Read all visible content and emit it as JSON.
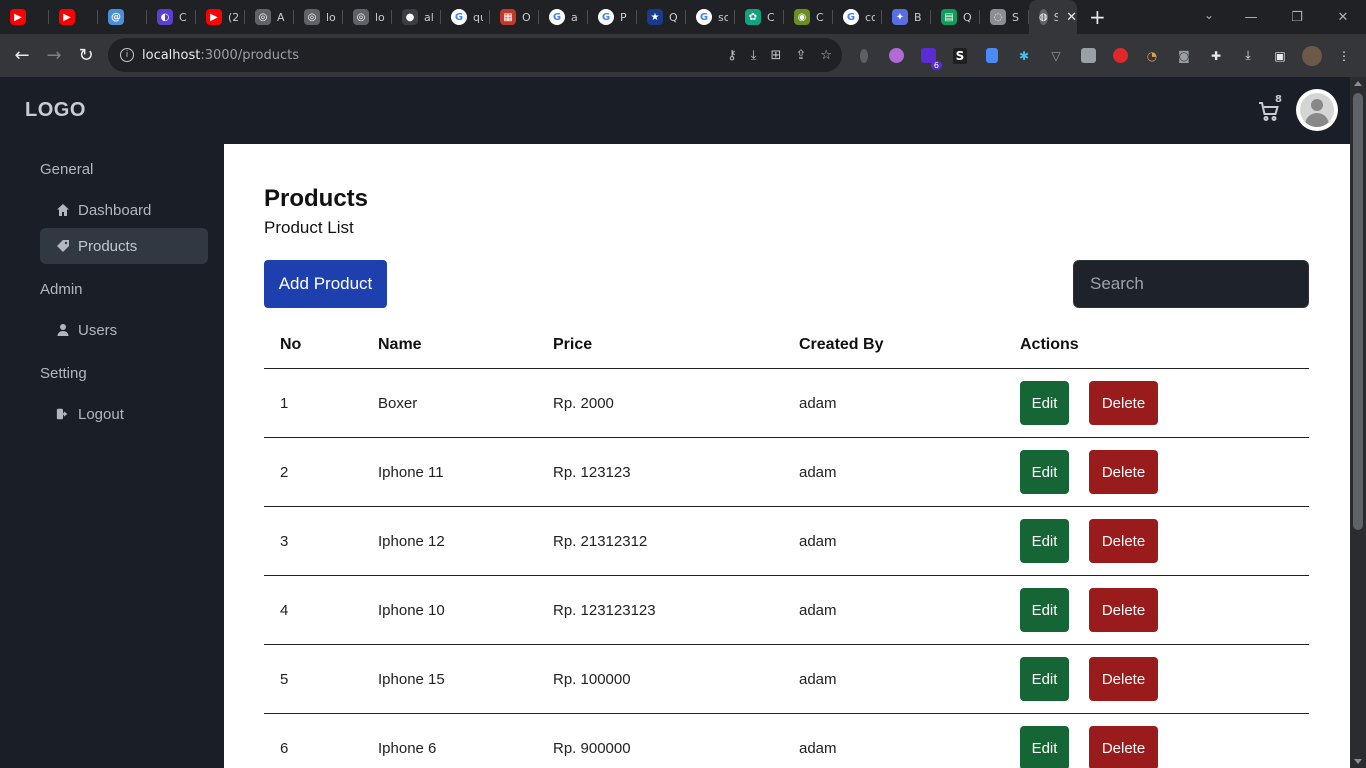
{
  "browser": {
    "tabs": [
      {
        "icon": "youtube-icon",
        "color": "#ff0000",
        "glyph": "▶",
        "title": ""
      },
      {
        "icon": "youtube-icon",
        "color": "#ff0000",
        "glyph": "▶",
        "title": ""
      },
      {
        "icon": "at-icon",
        "color": "#4a90d9",
        "glyph": "@",
        "title": ""
      },
      {
        "icon": "crescent-icon",
        "color": "#5b3fd1",
        "glyph": "◐",
        "title": "C"
      },
      {
        "icon": "youtube-icon",
        "color": "#ff0000",
        "glyph": "▶",
        "title": "(2"
      },
      {
        "icon": "globe-icon",
        "color": "#5f6368",
        "glyph": "◎",
        "title": "A"
      },
      {
        "icon": "globe-icon",
        "color": "#5f6368",
        "glyph": "◎",
        "title": "lo"
      },
      {
        "icon": "globe-icon",
        "color": "#5f6368",
        "glyph": "◎",
        "title": "lo"
      },
      {
        "icon": "github-icon",
        "color": "#3a3d41",
        "glyph": "●",
        "title": "al"
      },
      {
        "icon": "google-icon",
        "color": "#ffffff",
        "glyph": "G",
        "title": "qu"
      },
      {
        "icon": "grid-icon",
        "color": "#c0392b",
        "glyph": "▦",
        "title": "O"
      },
      {
        "icon": "google-icon",
        "color": "#ffffff",
        "glyph": "G",
        "title": "a"
      },
      {
        "icon": "google-icon",
        "color": "#ffffff",
        "glyph": "G",
        "title": "P"
      },
      {
        "icon": "star-icon",
        "color": "#1a3a8a",
        "glyph": "★",
        "title": "Q"
      },
      {
        "icon": "google-icon",
        "color": "#ffffff",
        "glyph": "G",
        "title": "so"
      },
      {
        "icon": "openai-icon",
        "color": "#10a37f",
        "glyph": "✿",
        "title": "C"
      },
      {
        "icon": "badge-icon",
        "color": "#6b8e23",
        "glyph": "◉",
        "title": "C"
      },
      {
        "icon": "google-icon",
        "color": "#ffffff",
        "glyph": "G",
        "title": "cc"
      },
      {
        "icon": "sparkle-icon",
        "color": "#5b6ee1",
        "glyph": "✦",
        "title": "B"
      },
      {
        "icon": "sheets-icon",
        "color": "#0f9d58",
        "glyph": "▤",
        "title": "Q"
      },
      {
        "icon": "bulb-icon",
        "color": "#8a8d91",
        "glyph": "◌",
        "title": "S"
      }
    ],
    "active_tab": {
      "icon": "globe-icon",
      "title": "Si",
      "close": "✕"
    },
    "new_tab": "+",
    "url_host": "localhost",
    "url_rest": ":3000/products",
    "window_controls": {
      "minimize": "—",
      "maximize": "❐",
      "close": "✕"
    },
    "extensions_badge": "6",
    "ext_letter": "S"
  },
  "app": {
    "logo": "LOGO",
    "cart_count": "8",
    "sidebar": {
      "sections": [
        {
          "label": "General",
          "items": [
            {
              "label": "Dashboard",
              "icon": "home-icon"
            },
            {
              "label": "Products",
              "icon": "tag-icon",
              "active": true
            }
          ]
        },
        {
          "label": "Admin",
          "items": [
            {
              "label": "Users",
              "icon": "user-icon"
            }
          ]
        },
        {
          "label": "Setting",
          "items": [
            {
              "label": "Logout",
              "icon": "logout-icon"
            }
          ]
        }
      ]
    },
    "main": {
      "title": "Products",
      "subtitle": "Product List",
      "add_button": "Add Product",
      "search_placeholder": "Search",
      "table": {
        "headers": [
          "No",
          "Name",
          "Price",
          "Created By",
          "Actions"
        ],
        "rows": [
          {
            "no": "1",
            "name": "Boxer",
            "price": "Rp. 2000",
            "created_by": "adam"
          },
          {
            "no": "2",
            "name": "Iphone 11",
            "price": "Rp. 123123",
            "created_by": "adam"
          },
          {
            "no": "3",
            "name": "Iphone 12",
            "price": "Rp. 21312312",
            "created_by": "adam"
          },
          {
            "no": "4",
            "name": "Iphone 10",
            "price": "Rp. 123123123",
            "created_by": "adam"
          },
          {
            "no": "5",
            "name": "Iphone 15",
            "price": "Rp. 100000",
            "created_by": "adam"
          },
          {
            "no": "6",
            "name": "Iphone 6",
            "price": "Rp. 900000",
            "created_by": "adam"
          }
        ],
        "edit_label": "Edit",
        "delete_label": "Delete"
      }
    }
  }
}
